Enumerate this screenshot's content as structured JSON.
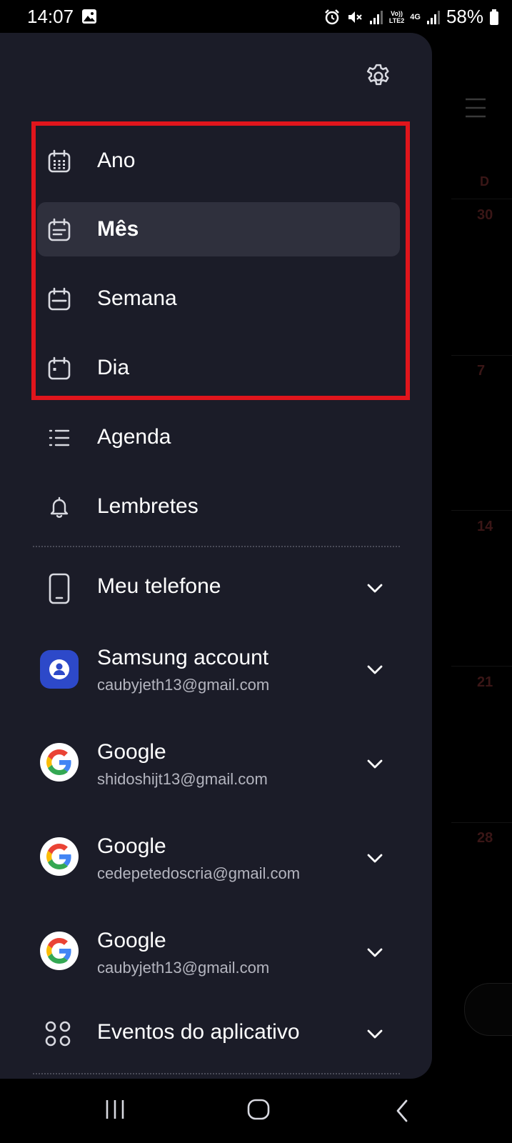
{
  "status_bar": {
    "time": "14:07",
    "battery": "58%",
    "network_top": "Vo))",
    "network_bottom": "LTE2",
    "network_type": "4G",
    "icons": [
      "gallery-icon",
      "alarm-icon",
      "mute-icon",
      "signal-icon",
      "lte-icon",
      "signal-icon",
      "battery-icon"
    ]
  },
  "background_calendar": {
    "day_label": "D",
    "dates": [
      "30",
      "7",
      "14",
      "21",
      "28"
    ]
  },
  "drawer": {
    "settings_icon": "gear-icon",
    "views": [
      {
        "label": "Ano",
        "icon": "calendar-year-icon",
        "selected": false
      },
      {
        "label": "Mês",
        "icon": "calendar-month-icon",
        "selected": true
      },
      {
        "label": "Semana",
        "icon": "calendar-week-icon",
        "selected": false
      },
      {
        "label": "Dia",
        "icon": "calendar-day-icon",
        "selected": false
      }
    ],
    "other_views": [
      {
        "label": "Agenda",
        "icon": "list-icon"
      },
      {
        "label": "Lembretes",
        "icon": "bell-icon"
      }
    ],
    "accounts": [
      {
        "name": "Meu telefone",
        "email": "",
        "icon": "phone-icon"
      },
      {
        "name": "Samsung account",
        "email": "caubyjeth13@gmail.com",
        "icon": "samsung-account-icon"
      },
      {
        "name": "Google",
        "email": "shidoshijt13@gmail.com",
        "icon": "google-icon"
      },
      {
        "name": "Google",
        "email": "cedepetedoscria@gmail.com",
        "icon": "google-icon"
      },
      {
        "name": "Google",
        "email": "caubyjeth13@gmail.com",
        "icon": "google-icon"
      },
      {
        "name": "Eventos do aplicativo",
        "email": "",
        "icon": "apps-grid-icon"
      }
    ]
  },
  "colors": {
    "drawer_bg": "#1b1c28",
    "selected_bg": "#2f303d",
    "highlight_border": "#e0151c",
    "secondary_text": "#b4b5bf"
  },
  "nav_bar": {
    "buttons": [
      "recent-apps-icon",
      "home-icon",
      "back-icon"
    ]
  }
}
